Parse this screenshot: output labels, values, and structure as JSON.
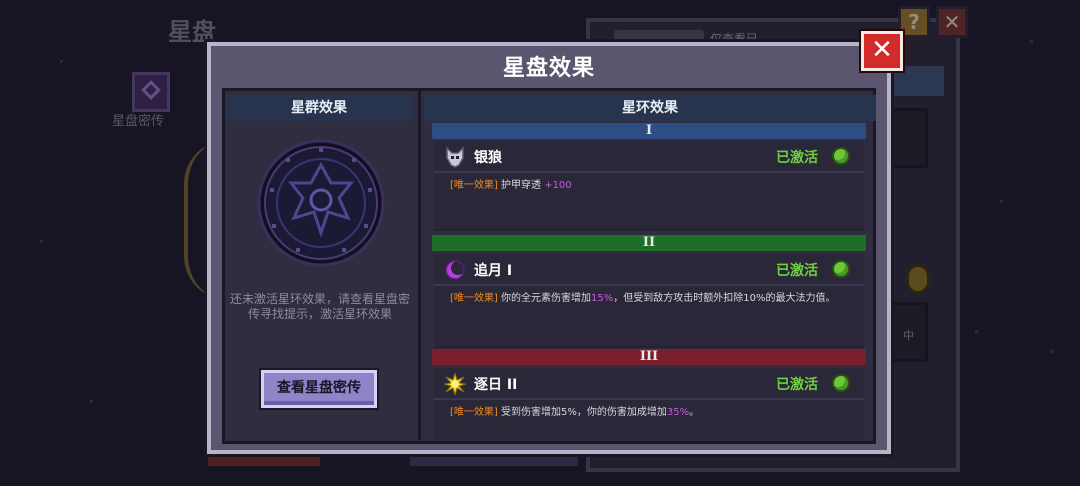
{
  "background": {
    "title": "星盘",
    "tome_label": "星盘密传",
    "panel_tab": "仅查看已",
    "help_glyph": "?",
    "close_glyph": "✕",
    "slot_text": "中"
  },
  "dialog": {
    "title": "星盘效果",
    "close_glyph": "✕"
  },
  "left": {
    "header": "星群效果",
    "hint": "还未激活星环效果，请查看星盘密传寻找提示，激活星环效果",
    "button": "查看星盘密传"
  },
  "right": {
    "header": "星环效果",
    "tiers": [
      {
        "numeral": "I",
        "color": "#2c4d86",
        "name": "银狼",
        "icon": "wolf-icon",
        "status": "已激活",
        "tag": "[唯一效果]",
        "desc_a": "护甲穿透",
        "desc_hl": "+100",
        "desc_b": ""
      },
      {
        "numeral": "II",
        "color": "#1e6e28",
        "name": "追月 I",
        "icon": "moon-icon",
        "status": "已激活",
        "tag": "[唯一效果]",
        "desc_a": "你的全元素伤害增加",
        "desc_hl": "15%",
        "desc_b": "，但受到敌方攻击时额外扣除10%的最大法力值。"
      },
      {
        "numeral": "III",
        "color": "#7a1e2a",
        "name": "逐日 II",
        "icon": "sun-icon",
        "status": "已激活",
        "tag": "[唯一效果]",
        "desc_a": "受到伤害增加5%，你的伤害加成增加",
        "desc_hl": "35%",
        "desc_b": "。"
      }
    ]
  },
  "colors": {
    "active_green": "#6cd040",
    "tag_orange": "#f08a20",
    "highlight_purple": "#c85ae0",
    "close_red": "#d32a2a"
  }
}
